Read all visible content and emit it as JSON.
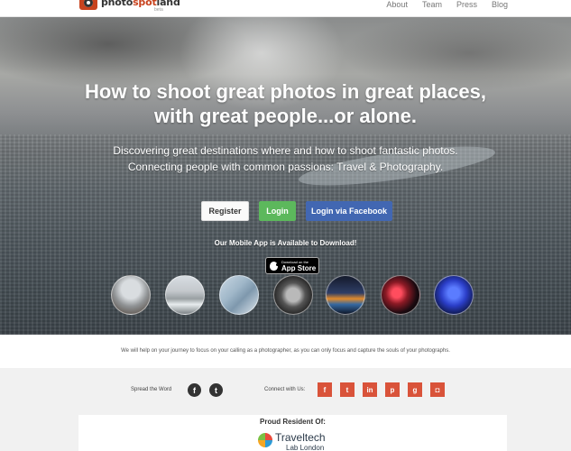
{
  "header": {
    "logo_prefix": "photo",
    "logo_accent": "spot",
    "logo_suffix": "land",
    "logo_beta": "beta",
    "nav": [
      "About",
      "Team",
      "Press",
      "Blog"
    ]
  },
  "hero": {
    "headline_line1": "How to shoot great photos in great places,",
    "headline_line2": "with great people...or alone.",
    "sub_line1": "Discovering great destinations where and how to shoot fantastic photos.",
    "sub_line2": "Connecting people with common passions: Travel & Photography.",
    "register_label": "Register",
    "login_label": "Login",
    "facebook_label": "Login via Facebook",
    "mobile_label": "Our Mobile App is Available to Download!",
    "appstore_small": "Download on the",
    "appstore_big": "App Store"
  },
  "tagline": "We will help on your journey to focus on your calling as a photographer, as you can only focus and capture the souls of your photographs.",
  "social": {
    "spread_label": "Spread the Word",
    "spread_icons": [
      "facebook-icon",
      "twitter-icon"
    ],
    "connect_label": "Connect with Us:",
    "connect_icons": [
      {
        "name": "facebook-icon",
        "glyph": "f"
      },
      {
        "name": "twitter-icon",
        "glyph": "t"
      },
      {
        "name": "linkedin-icon",
        "glyph": "in"
      },
      {
        "name": "pinterest-icon",
        "glyph": "p"
      },
      {
        "name": "google-plus-icon",
        "glyph": "g"
      },
      {
        "name": "instagram-icon",
        "glyph": "◘"
      }
    ]
  },
  "resident": {
    "title": "Proud Resident Of:",
    "name": "Traveltech",
    "sub": "Lab London"
  },
  "colors": {
    "login_green": "#5cb85c",
    "facebook_blue": "#4267b2",
    "social_red": "#d9533a",
    "brand_orange": "#c8431e"
  }
}
